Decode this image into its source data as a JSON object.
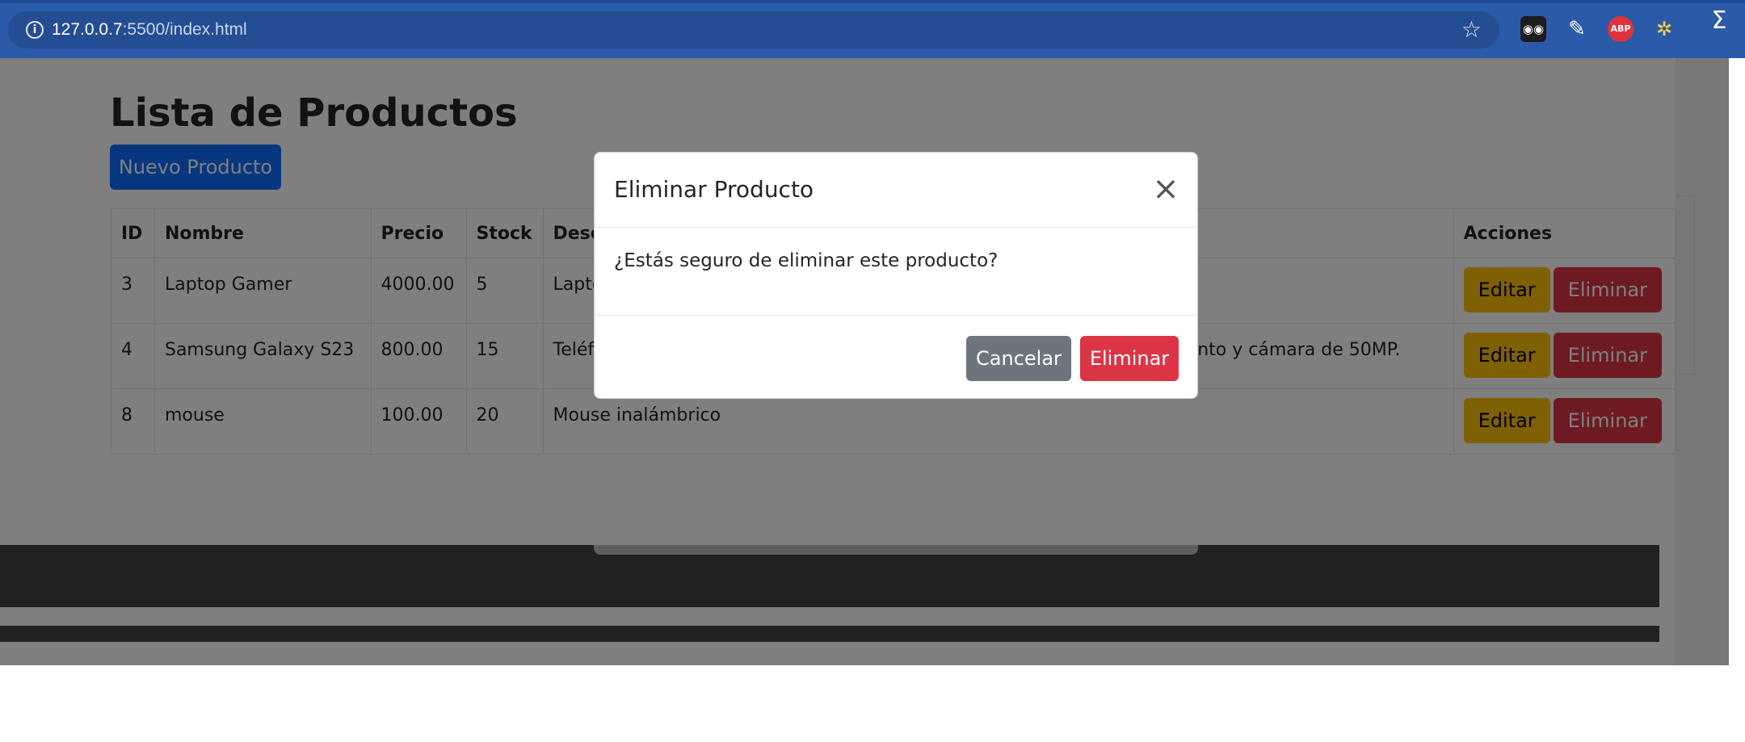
{
  "browser": {
    "url_host": "127.0.0.7",
    "url_path": ":5500/index.html",
    "info_icon": "info-icon",
    "star_icon": "star-icon",
    "extensions": [
      "incognito-glasses-icon",
      "eyedropper-icon",
      "adblock-icon",
      "extension-multi-icon",
      "sigma-icon"
    ],
    "abp_label": "ABP"
  },
  "page": {
    "title": "Lista de Productos",
    "new_button": "Nuevo Producto",
    "table": {
      "headers": [
        "ID",
        "Nombre",
        "Precio",
        "Stock",
        "Desc",
        "Acciones"
      ],
      "rows": [
        {
          "id": "3",
          "name": "Laptop Gamer",
          "price": "4000.00",
          "stock": "5",
          "description": "Lapto",
          "edit": "Editar",
          "delete": "Eliminar"
        },
        {
          "id": "4",
          "name": "Samsung Galaxy S23",
          "price": "800.00",
          "stock": "15",
          "description": "Teléfono con pantalla AMOLED de 6.5 pulgadas, 128GB de almacenamiento y cámara de 50MP.",
          "edit": "Editar",
          "delete": "Eliminar"
        },
        {
          "id": "8",
          "name": "mouse",
          "price": "100.00",
          "stock": "20",
          "description": "Mouse inalámbrico",
          "edit": "Editar",
          "delete": "Eliminar"
        }
      ]
    }
  },
  "modal": {
    "title": "Eliminar Producto",
    "close_icon": "close-icon",
    "message": "¿Estás seguro de eliminar este producto?",
    "cancel": "Cancelar",
    "confirm": "Eliminar"
  },
  "colors": {
    "primary": "#0d6efd",
    "warning": "#ffc107",
    "danger": "#dc3545",
    "secondary": "#6c757d",
    "chrome": "#2b5aa8"
  }
}
